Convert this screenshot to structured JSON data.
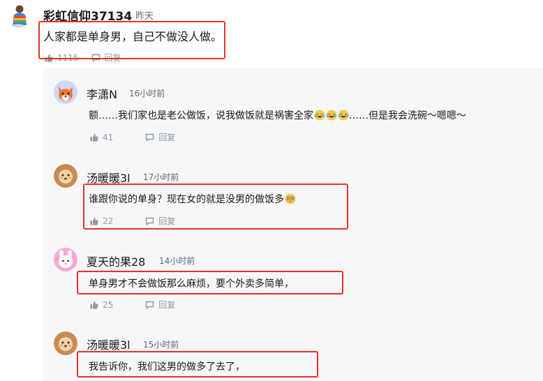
{
  "top_comment": {
    "username": "彩虹信仰37134",
    "time": "昨天",
    "text": "人家都是单身男，自己不做没人做。",
    "likes": "1115",
    "reply_label": "回复"
  },
  "replies": [
    {
      "username": "李潇N",
      "time": "16小时前",
      "text_before": "额……我们家也是老公做饭，说我做饭就是祸害全家",
      "text_after": "……但是我会洗碗～嗯嗯～",
      "likes": "41",
      "reply_label": "回复"
    },
    {
      "username": "汤暖暖3l",
      "time": "17小时前",
      "text": "谁跟你说的单身？现在女的就是没男的做饭多",
      "likes": "22",
      "reply_label": "回复"
    },
    {
      "username": "夏天的果28",
      "time": "14小时前",
      "text": "单身男才不会做饭那么麻烦，要个外卖多简单，",
      "likes": "25",
      "reply_label": "回复"
    },
    {
      "username": "汤暖暖3l",
      "time": "15小时前",
      "text": "我告诉你，我们这男的做多了去了，"
    }
  ],
  "colors": {
    "highlight_box": "#e8302a",
    "reply_bg": "#f6f7f8",
    "meta_text": "#9499a0"
  },
  "icons": {
    "like": "thumbs-up-icon",
    "reply": "reply-bubble-icon",
    "emoji_laugh": "laughing-tears-emoji",
    "emoji_blush": "flushed-emoji"
  }
}
